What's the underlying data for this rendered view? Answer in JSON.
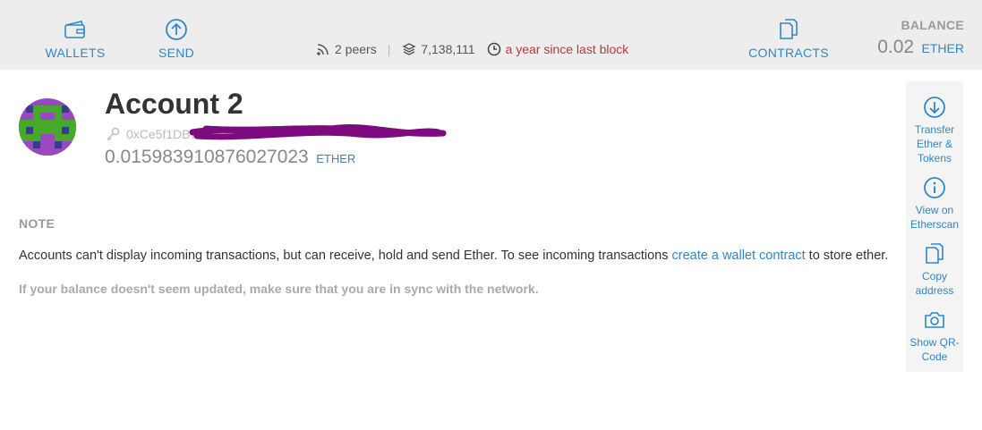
{
  "nav": {
    "wallets": "WALLETS",
    "send": "SEND",
    "contracts": "CONTRACTS"
  },
  "status": {
    "peers": "2 peers",
    "separator": "|",
    "block": "7,138,111",
    "last_block": "a year since last block"
  },
  "balance": {
    "label": "BALANCE",
    "value": "0.02",
    "unit": "ETHER"
  },
  "account": {
    "title": "Account 2",
    "address": "0xCe5f1DB7E",
    "balance": "0.015983910876027023",
    "unit": "ETHER"
  },
  "note": {
    "title": "NOTE",
    "text_before": "Accounts can't display incoming transactions, but can receive, hold and send Ether. To see incoming transactions ",
    "link": "create a wallet contract",
    "text_after": " to store ether.",
    "warning": "If your balance doesn't seem updated, make sure that you are in sync with the network."
  },
  "actions": {
    "transfer": "Transfer Ether & Tokens",
    "etherscan": "View on Etherscan",
    "copy": "Copy address",
    "qr": "Show QR-Code"
  },
  "icons": {
    "wallets": "wallet-icon",
    "send": "arrow-up-circle-icon",
    "contracts": "documents-icon",
    "peers": "signal-icon",
    "block": "layers-icon",
    "clock": "clock-icon",
    "key": "key-icon",
    "transfer": "arrow-down-circle-icon",
    "etherscan": "info-circle-icon",
    "copy": "copy-icon",
    "qr": "camera-icon"
  },
  "colors": {
    "accent": "#2f87c8",
    "warning": "#b63a3a",
    "header_bg": "#ededed",
    "redaction": "#7d0a7e"
  }
}
